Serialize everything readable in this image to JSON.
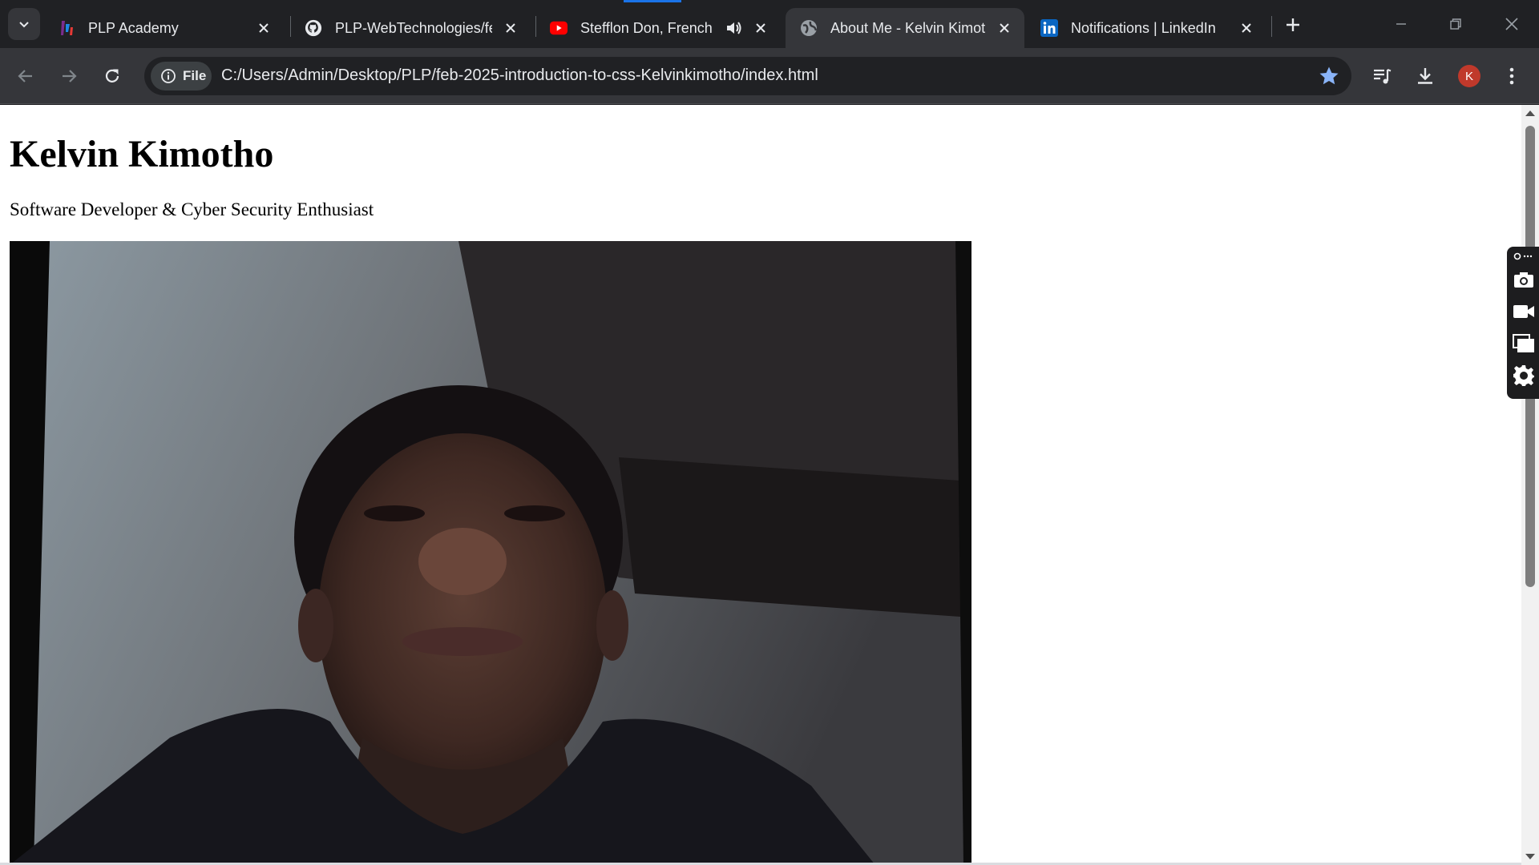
{
  "browser": {
    "tabs": [
      {
        "title": "PLP Academy",
        "favicon": "plp-academy-favicon",
        "active": false
      },
      {
        "title": "PLP-WebTechnologies/fe",
        "favicon": "github-favicon",
        "active": false
      },
      {
        "title": "Stefflon Don, French",
        "favicon": "youtube-favicon",
        "active": false,
        "audio": true
      },
      {
        "title": "About Me - Kelvin Kimot",
        "favicon": "globe-favicon",
        "active": true
      },
      {
        "title": "Notifications | LinkedIn",
        "favicon": "linkedin-favicon",
        "active": false
      }
    ],
    "site_chip_label": "File",
    "url": "C:/Users/Admin/Desktop/PLP/feb-2025-introduction-to-css-Kelvinkimotho/index.html",
    "profile_initial": "K",
    "colors": {
      "frame": "#202124",
      "toolbar": "#35363a",
      "star": "#8ab4f8",
      "profile": "#c0392b"
    }
  },
  "page": {
    "heading": "Kelvin Kimotho",
    "subtitle": "Software Developer & Cyber Security Enthusiast"
  },
  "capture_widget": {
    "icons": [
      "camera-icon",
      "video-icon",
      "screens-icon",
      "gear-icon"
    ]
  }
}
